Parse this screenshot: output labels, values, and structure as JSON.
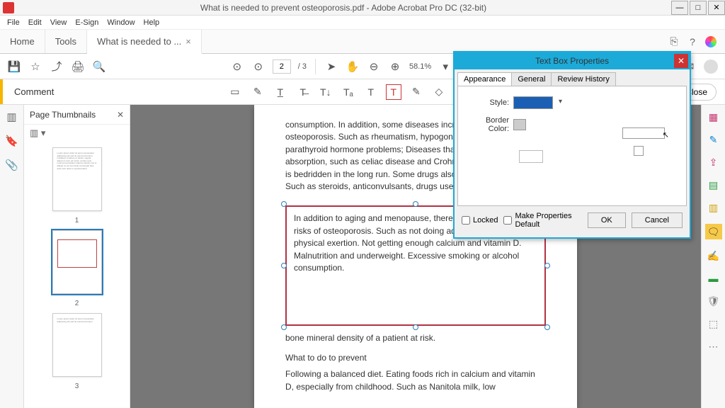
{
  "titlebar": {
    "text": "What is needed to prevent osteoporosis.pdf - Adobe Acrobat Pro DC (32-bit)"
  },
  "menu": {
    "file": "File",
    "edit": "Edit",
    "view": "View",
    "esign": "E-Sign",
    "window": "Window",
    "help": "Help"
  },
  "tabs": {
    "home": "Home",
    "tools": "Tools",
    "doc": "What is needed to ..."
  },
  "toolbar": {
    "page_current": "2",
    "page_total": "/ 3",
    "zoom": "58.1%"
  },
  "comment": {
    "label": "Comment",
    "close": "Close"
  },
  "thumbs": {
    "title": "Page Thumbnails",
    "p1": "1",
    "p2": "2",
    "p3": "3"
  },
  "thumbfill": {
    "a": "Lorem ipsum dolor sit amet consectetur adipiscing elit sed do eiusmod tempor incididunt ut labore et dolore magna aliqua ut enim ad minim veniam quis nostrud exercitation ullamco laboris nisi ut aliquip ex ea commodo consequat duis aute irure dolor in reprehenderit",
    "c": "Lorem ipsum dolor sit amet consectetur adipiscing elit sed do eiusmod tempor"
  },
  "doc": {
    "para1": "consumption. In addition, some diseases increase the risk of osteoporosis. Such as rheumatism, hypogonadism, thyroid or parathyroid hormone problems; Diseases that interfere with food absorption, such as celiac disease and Crohn's disease. If someone is bedridden in the long run. Some drugs also increase bone loss. Such as steroids, anticonvulsants, drugs used to treat cancer.",
    "textbox": "In addition to aging and menopause, there are other causes and risks of osteoporosis. Such as not doing adequate amount of physical exertion. Not getting enough calcium and vitamin D. Malnutrition and underweight. Excessive smoking or alcohol consumption.",
    "behind": "bone mineral density of a patient at risk.",
    "h2": "What to do to prevent",
    "para2": "Following a balanced diet. Eating foods rich in calcium and vitamin D, especially from childhood. Such as Nanitola milk, low"
  },
  "dialog": {
    "title": "Text Box Properties",
    "tabs": {
      "appearance": "Appearance",
      "general": "General",
      "review": "Review History"
    },
    "style_label": "Style:",
    "border_label": "Border Color:",
    "locked": "Locked",
    "makedefault": "Make Properties Default",
    "ok": "OK",
    "cancel": "Cancel"
  }
}
